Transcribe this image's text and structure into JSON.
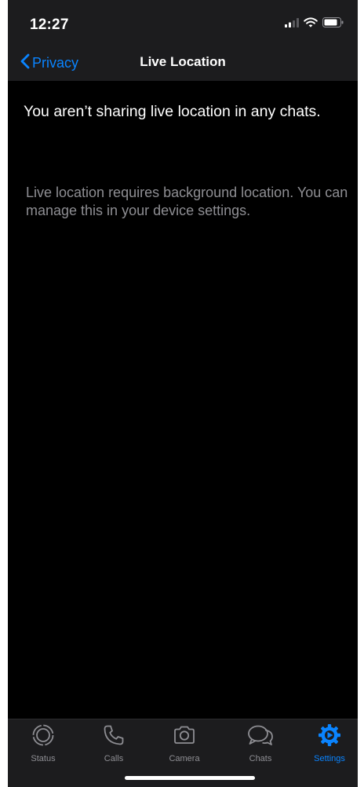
{
  "status_bar": {
    "time": "12:27"
  },
  "nav": {
    "back_label": "Privacy",
    "title": "Live Location"
  },
  "content": {
    "notice": "You aren’t sharing live location in any chats.",
    "footnote": "Live location requires background location. You can manage this in your device settings."
  },
  "tabs": [
    {
      "label": "Status",
      "icon": "status-icon",
      "active": false
    },
    {
      "label": "Calls",
      "icon": "phone-icon",
      "active": false
    },
    {
      "label": "Camera",
      "icon": "camera-icon",
      "active": false
    },
    {
      "label": "Chats",
      "icon": "chat-bubbles-icon",
      "active": false
    },
    {
      "label": "Settings",
      "icon": "gear-icon",
      "active": true
    }
  ],
  "colors": {
    "accent": "#0a84ff",
    "background": "#000000",
    "bar_background": "#1c1c1e",
    "secondary_text": "#8e8e93"
  }
}
